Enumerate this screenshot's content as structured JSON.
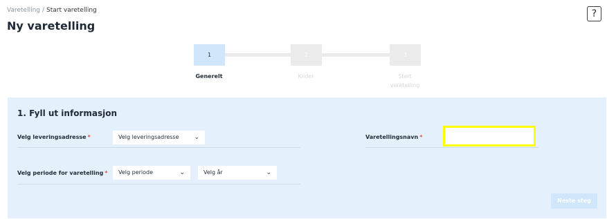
{
  "breadcrumb": {
    "parent": "Varetelling",
    "separator": "/",
    "current": "Start varetelling"
  },
  "page_title": "Ny varetelling",
  "help_label": "?",
  "stepper": {
    "steps": [
      {
        "number": "1",
        "label": "Generelt",
        "state": "active"
      },
      {
        "number": "2",
        "label": "Kilder",
        "state": "inactive"
      },
      {
        "number": "3",
        "label": "Start varetelling",
        "state": "inactive"
      }
    ]
  },
  "form": {
    "section_title": "1. Fyll ut informasjon",
    "required_mark": "*",
    "delivery_address": {
      "label": "Velg leveringsadresse",
      "value": "Velg leveringsadresse"
    },
    "count_name": {
      "label": "Varetellingsnavn",
      "value": ""
    },
    "period": {
      "label": "Velg periode for varetelling",
      "period_value": "Velg periode",
      "year_value": "Velg år"
    },
    "next_button": "Neste steg"
  },
  "colors": {
    "panel_bg": "#e4f0fb",
    "active_step": "#cfe6fb",
    "inactive_step": "#ebebeb",
    "required": "#d9534f",
    "highlight": "#ffff00"
  }
}
